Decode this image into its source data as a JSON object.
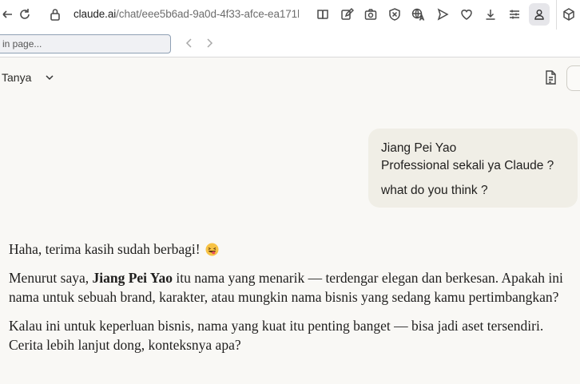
{
  "browser": {
    "url_host": "claude.ai",
    "url_path": "/chat/eee5b6ad-9a0d-4f33-afce-ea171b",
    "icons": [
      "reload-icon",
      "site-info-icon",
      "reader-view-icon",
      "edit-icon",
      "screenshot-icon",
      "shield-icon",
      "translate-icon",
      "send-icon",
      "heart-icon",
      "download-icon",
      "menu-icon",
      "profile-icon",
      "extension-icon"
    ]
  },
  "find_bar": {
    "placeholder": "in page..."
  },
  "header": {
    "project_name": "Tanya"
  },
  "conversation": {
    "user_message": {
      "line1": "Jiang Pei Yao",
      "line2": "Professional sekali ya Claude ?",
      "line3": "what do you think ?"
    },
    "assistant": {
      "p1": "Haha, terima kasih sudah berbagi!",
      "p1_emoji": "grinning-tongue-emoji",
      "p2_before": "Menurut saya, ",
      "p2_bold": "Jiang Pei Yao",
      "p2_after": " itu nama yang menarik — terdengar elegan dan berkesan. Apakah ini nama untuk sebuah brand, karakter, atau mungkin nama bisnis yang sedang kamu pertimbangkan?",
      "p3": "Kalau ini untuk keperluan bisnis, nama yang kuat itu penting banget — bisa jadi aset tersendiri. Cerita lebih lanjut dong, konteksnya apa?"
    }
  },
  "colors": {
    "page_bg": "#f9f8f5",
    "user_bubble_bg": "#f0eee6",
    "text": "#1f1e1d"
  }
}
